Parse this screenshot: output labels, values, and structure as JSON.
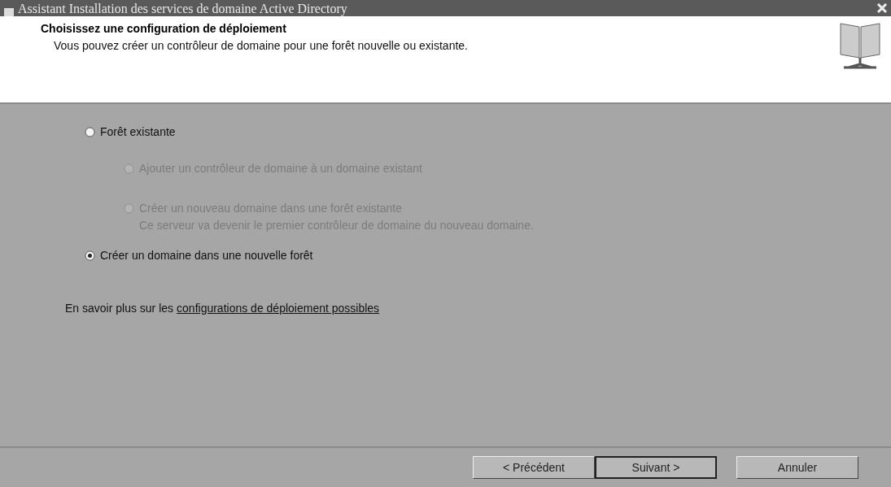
{
  "window": {
    "title": "Assistant Installation des services de domaine Active Directory"
  },
  "header": {
    "title": "Choisissez une configuration de déploiement",
    "subtitle": "Vous pouvez créer un contrôleur de domaine pour une forêt nouvelle ou existante."
  },
  "options": [
    {
      "label": "Forêt existante",
      "selected": false,
      "disabled": false,
      "children": [
        {
          "label": "Ajouter un contrôleur de domaine à un domaine existant",
          "selected": false,
          "disabled": true
        },
        {
          "label": "Créer un nouveau domaine dans une forêt existante",
          "description": "Ce serveur va devenir le premier contrôleur de domaine du nouveau domaine.",
          "selected": false,
          "disabled": true
        }
      ]
    },
    {
      "label": "Créer un domaine dans une nouvelle forêt",
      "selected": true,
      "disabled": false
    }
  ],
  "help": {
    "text": "En savoir plus sur les",
    "link": "configurations de déploiement possibles"
  },
  "buttons": [
    {
      "label": "< Précédent",
      "default": false
    },
    {
      "label": "Suivant >",
      "default": true
    },
    {
      "label": "Annuler",
      "default": false
    }
  ]
}
